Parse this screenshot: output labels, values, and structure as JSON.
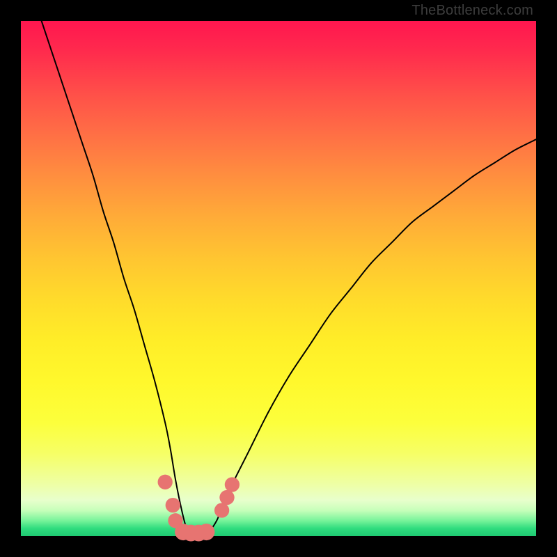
{
  "watermark": "TheBottleneck.com",
  "chart_data": {
    "type": "line",
    "title": "",
    "xlabel": "",
    "ylabel": "",
    "xlim": [
      0,
      100
    ],
    "ylim": [
      0,
      100
    ],
    "grid": false,
    "series": [
      {
        "name": "curve",
        "color": "#000000",
        "x": [
          4,
          6,
          8,
          10,
          12,
          14,
          16,
          18,
          20,
          22,
          24,
          26,
          28,
          29,
          30,
          31,
          32,
          33,
          34,
          36,
          38,
          40,
          44,
          48,
          52,
          56,
          60,
          64,
          68,
          72,
          76,
          80,
          84,
          88,
          92,
          96,
          100
        ],
        "y": [
          100,
          94,
          88,
          82,
          76,
          70,
          63,
          57,
          50,
          44,
          37,
          30,
          22,
          17,
          11,
          6,
          2,
          0.5,
          0.5,
          0.5,
          3,
          8,
          16,
          24,
          31,
          37,
          43,
          48,
          53,
          57,
          61,
          64,
          67,
          70,
          72.5,
          75,
          77
        ]
      }
    ],
    "markers": [
      {
        "x": 28.0,
        "y": 10.5,
        "r": 1.0
      },
      {
        "x": 29.5,
        "y": 6.0,
        "r": 1.0
      },
      {
        "x": 30.0,
        "y": 3.0,
        "r": 1.0
      },
      {
        "x": 31.5,
        "y": 0.8,
        "r": 1.2
      },
      {
        "x": 33.0,
        "y": 0.6,
        "r": 1.2
      },
      {
        "x": 34.5,
        "y": 0.6,
        "r": 1.2
      },
      {
        "x": 36.0,
        "y": 0.8,
        "r": 1.2
      },
      {
        "x": 39.0,
        "y": 5.0,
        "r": 1.0
      },
      {
        "x": 40.0,
        "y": 7.5,
        "r": 1.0
      },
      {
        "x": 41.0,
        "y": 10.0,
        "r": 1.0
      }
    ],
    "marker_color": "#e77471"
  }
}
